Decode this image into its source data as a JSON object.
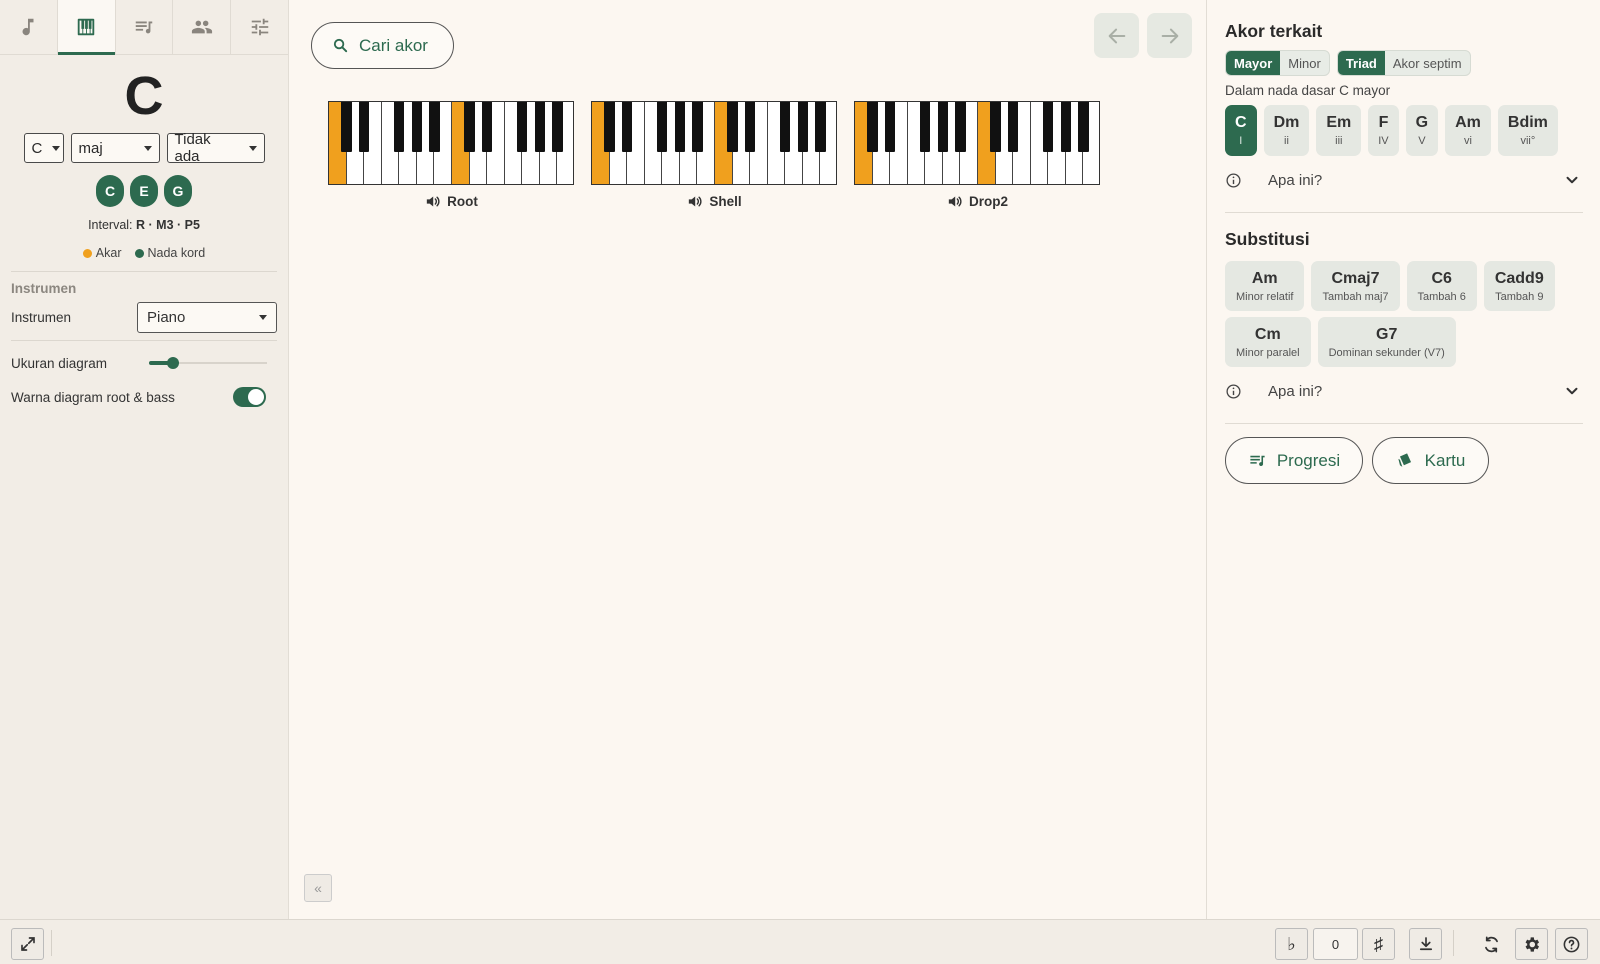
{
  "left": {
    "tabs": [
      {
        "icon": "music-note-icon",
        "active": false
      },
      {
        "icon": "piano-icon",
        "active": true
      },
      {
        "icon": "playlist-icon",
        "active": false
      },
      {
        "icon": "people-icon",
        "active": false
      },
      {
        "icon": "tune-icon",
        "active": false
      }
    ],
    "chord_name": "C",
    "root_select": "C",
    "quality_select": "maj",
    "extension_select": "Tidak ada",
    "notes": [
      "C",
      "E",
      "G"
    ],
    "interval_label": "Interval:",
    "interval_value": "R · M3 · P5",
    "legend_root": "Akar",
    "legend_chord": "Nada kord",
    "legend_root_color": "#f0a01e",
    "legend_chord_color": "#2d6a4f",
    "instrument_section": "Instrumen",
    "instrument_label": "Instrumen",
    "instrument_value": "Piano",
    "diagram_size_label": "Ukuran diagram",
    "diagram_size_value": 0.2,
    "root_bass_color_label": "Warna diagram root & bass",
    "root_bass_color_on": true
  },
  "center": {
    "search_label": "Cari akor",
    "keyboards": [
      {
        "label": "Root",
        "highlight_whites": [
          0,
          7
        ]
      },
      {
        "label": "Shell",
        "highlight_whites": [
          0,
          7
        ]
      },
      {
        "label": "Drop2",
        "highlight_whites": [
          0,
          7
        ]
      }
    ]
  },
  "right": {
    "related_title": "Akor terkait",
    "mode_segments": [
      "Mayor",
      "Minor"
    ],
    "mode_active": "Mayor",
    "type_segments": [
      "Triad",
      "Akor septim"
    ],
    "type_active": "Triad",
    "key_hint": "Dalam nada dasar C mayor",
    "diatonic": [
      {
        "name": "C",
        "degree": "I",
        "active": true
      },
      {
        "name": "Dm",
        "degree": "ii",
        "active": false
      },
      {
        "name": "Em",
        "degree": "iii",
        "active": false
      },
      {
        "name": "F",
        "degree": "IV",
        "active": false
      },
      {
        "name": "G",
        "degree": "V",
        "active": false
      },
      {
        "name": "Am",
        "degree": "vi",
        "active": false
      },
      {
        "name": "Bdim",
        "degree": "vii°",
        "active": false
      }
    ],
    "whatis_1": "Apa ini?",
    "subs_title": "Substitusi",
    "substitutions": [
      {
        "name": "Am",
        "desc": "Minor relatif"
      },
      {
        "name": "Cmaj7",
        "desc": "Tambah maj7"
      },
      {
        "name": "C6",
        "desc": "Tambah 6"
      },
      {
        "name": "Cadd9",
        "desc": "Tambah 9"
      },
      {
        "name": "Cm",
        "desc": "Minor paralel"
      },
      {
        "name": "G7",
        "desc": "Dominan sekunder (V7)"
      }
    ],
    "whatis_2": "Apa ini?",
    "progression_label": "Progresi",
    "card_label": "Kartu"
  },
  "bottom": {
    "flat": "♭",
    "transpose_value": "0",
    "sharp": "♯"
  },
  "colors": {
    "accent": "#2d6a4f",
    "root_highlight": "#f0a01e",
    "background": "#fcf7f1"
  }
}
